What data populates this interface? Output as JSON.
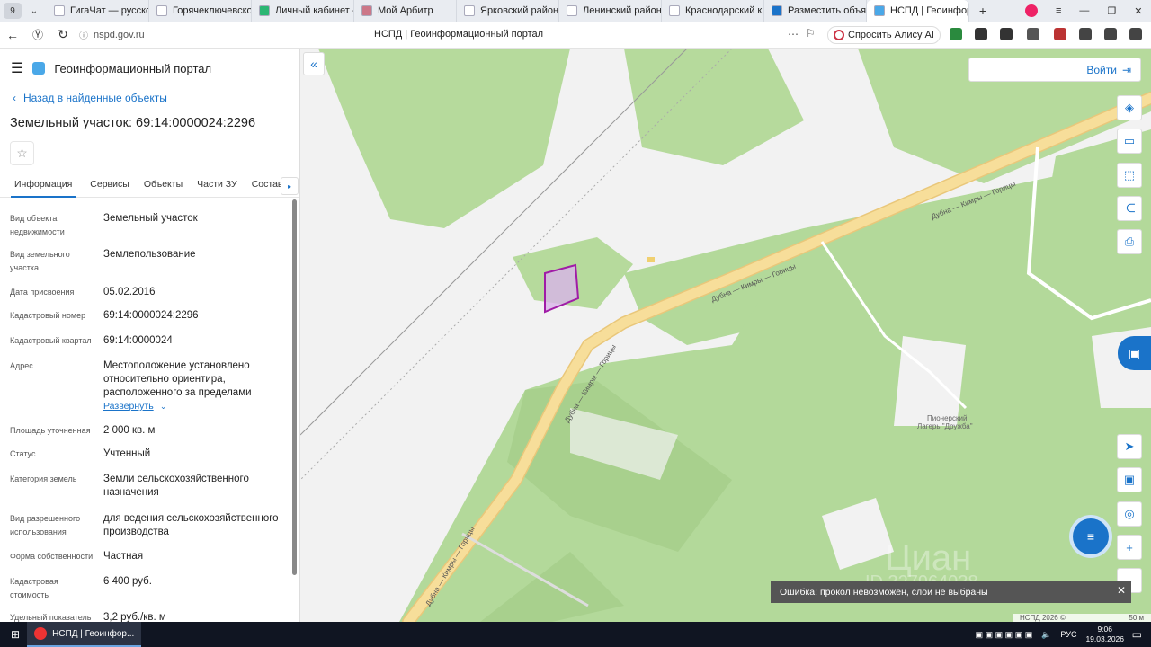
{
  "browser": {
    "tab_count": "9",
    "tabs": [
      {
        "title": "ГигаЧат — русскоязычн"
      },
      {
        "title": "Горячеключевской г"
      },
      {
        "title": "Личный кабинет - М"
      },
      {
        "title": "Мой Арбитр"
      },
      {
        "title": "Ярковский районны"
      },
      {
        "title": "Ленинский районны"
      },
      {
        "title": "Краснодарский крас"
      },
      {
        "title": "Разместить объявле"
      },
      {
        "title": "НСПД | Геоинфор"
      }
    ],
    "url": "nspd.gov.ru",
    "page_title": "НСПД | Геоинформационный портал",
    "alice_label": "Спросить Алису AI"
  },
  "portal": {
    "name": "Геоинформационный портал",
    "back_link": "Назад в найденные объекты",
    "object_title": "Земельный участок: 69:14:0000024:2296",
    "tabs": [
      "Информация",
      "Сервисы",
      "Объекты",
      "Части ЗУ",
      "Состав"
    ],
    "properties": [
      {
        "label": "Вид объекта недвижимости",
        "value": "Земельный участок"
      },
      {
        "label": "Вид земельного участка",
        "value": "Землепользование"
      },
      {
        "label": "Дата присвоения",
        "value": "05.02.2016"
      },
      {
        "label": "Кадастровый номер",
        "value": "69:14:0000024:2296"
      },
      {
        "label": "Кадастровый квартал",
        "value": "69:14:0000024"
      },
      {
        "label": "Адрес",
        "value": "Местоположение установлено относительно ориентира, расположенного за пределами"
      },
      {
        "label": "Площадь уточненная",
        "value": "2 000 кв. м"
      },
      {
        "label": "Статус",
        "value": "Учтенный"
      },
      {
        "label": "Категория земель",
        "value": "Земли сельскохозяйственного назначения"
      },
      {
        "label": "Вид разрешенного использования",
        "value": "для ведения сельскохозяйственного производства"
      },
      {
        "label": "Форма собственности",
        "value": "Частная"
      },
      {
        "label": "Кадастровая стоимость",
        "value": "6 400 руб."
      },
      {
        "label": "Удельный показатель",
        "value": "3,2 руб./кв. м"
      }
    ],
    "expand_label": "Развернуть"
  },
  "map": {
    "login_label": "Войти",
    "road_label": "Дубна — Кимры — Горицы",
    "camp_label_1": "Пионерский",
    "camp_label_2": "Лагерь \"Дружба\"",
    "watermark": "Циан",
    "watermark_id": "ID 327964938",
    "error_text": "Ошибка: прокол невозможен, слои не выбраны",
    "copyright": "НСПД 2026 ©",
    "scale_label": "50 м",
    "colors": {
      "forest": "#b3d99a",
      "meadow": "#a8d08d",
      "road": "#f5d88e",
      "parcel": "#a01ca7"
    }
  },
  "taskbar": {
    "app_label": "НСПД | Геоинфор...",
    "lang": "РУС",
    "time": "9:06",
    "date": "19.03.2026"
  }
}
